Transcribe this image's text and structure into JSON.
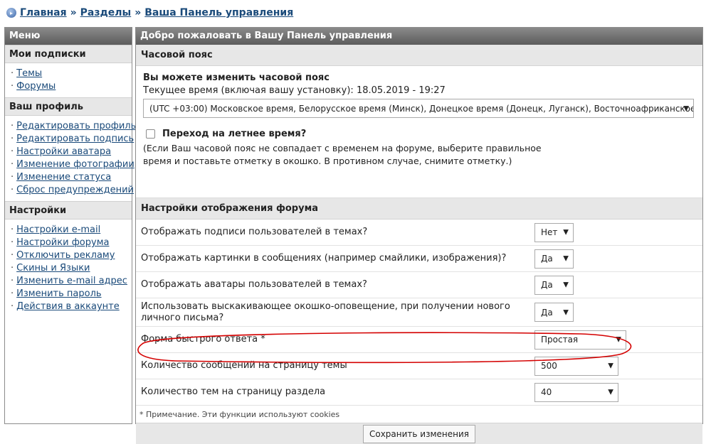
{
  "breadcrumb": {
    "items": [
      "Главная",
      "Разделы",
      "Ваша Панель управления"
    ],
    "separator": "»"
  },
  "sidebar": {
    "title": "Меню",
    "sections": [
      {
        "title": "Мои подписки",
        "items": [
          "Темы",
          "Форумы"
        ]
      },
      {
        "title": "Ваш профиль",
        "items": [
          "Редактировать профиль",
          "Редактировать подпись",
          "Настройки аватара",
          "Изменение фотографии",
          "Изменение статуса",
          "Сброс предупреждений"
        ]
      },
      {
        "title": "Настройки",
        "items": [
          "Настройки e-mail",
          "Настройки форума",
          "Отключить рекламу",
          "Скины и Языки",
          "Изменить e-mail адрес",
          "Изменить пароль",
          "Действия в аккаунте"
        ]
      }
    ]
  },
  "main": {
    "title": "Добро пожаловать в Вашу Панель управления",
    "timezone": {
      "section_title": "Часовой пояс",
      "heading": "Вы можете изменить часовой пояс",
      "current_time": "Текущее время (включая вашу установку): 18.05.2019 - 19:27",
      "selected": "(UTC +03:00) Московское время, Белорусское время (Минск), Донецкое время (Донецк, Луганск), Восточноафриканское время",
      "dst_label": "Переход на летнее время?",
      "dst_note": "(Если Ваш часовой пояс не совпадает с временем на форуме, выберите правильное время и поставьте отметку в окошко. В противном случае, снимите отметку.)"
    },
    "display": {
      "section_title": "Настройки отображения форума",
      "rows": [
        {
          "label": "Отображать подписи пользователей в темах?",
          "value": "Нет"
        },
        {
          "label": "Отображать картинки в сообщениях (например смайлики, изображения)?",
          "value": "Да"
        },
        {
          "label": "Отображать аватары пользователей в темах?",
          "value": "Да"
        },
        {
          "label": "Использовать выскакивающее окошко-оповещение, при получении нового личного письма?",
          "value": "Да"
        },
        {
          "label": "Форма быстрого ответа *",
          "value": "Простая"
        },
        {
          "label": "Количество сообщений на страницу темы",
          "value": "500"
        },
        {
          "label": "Количество тем на страницу раздела",
          "value": "40"
        }
      ]
    },
    "footnote": "* Примечание. Эти функции используют cookies",
    "save_label": "Сохранить изменения"
  },
  "colors": {
    "header_bar": "#6e6e6e",
    "section_bg": "#e7e7e7",
    "link": "#1a4a7a",
    "annotation": "#d40000"
  }
}
